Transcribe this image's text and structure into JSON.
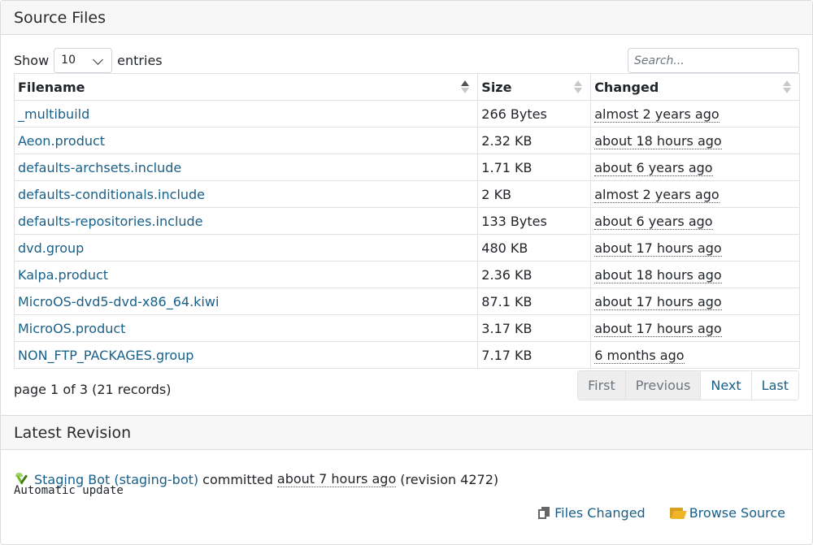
{
  "source_files": {
    "title": "Source Files",
    "show_label": "Show",
    "entries_label": "entries",
    "page_length": "10",
    "search_placeholder": "Search...",
    "columns": [
      "Filename",
      "Size",
      "Changed"
    ],
    "rows": [
      {
        "filename": "_multibuild",
        "size": "266 Bytes",
        "changed": "almost 2 years ago"
      },
      {
        "filename": "Aeon.product",
        "size": "2.32 KB",
        "changed": "about 18 hours ago"
      },
      {
        "filename": "defaults-archsets.include",
        "size": "1.71 KB",
        "changed": "about 6 years ago"
      },
      {
        "filename": "defaults-conditionals.include",
        "size": "2 KB",
        "changed": "almost 2 years ago"
      },
      {
        "filename": "defaults-repositories.include",
        "size": "133 Bytes",
        "changed": "about 6 years ago"
      },
      {
        "filename": "dvd.group",
        "size": "480 KB",
        "changed": "about 17 hours ago"
      },
      {
        "filename": "Kalpa.product",
        "size": "2.36 KB",
        "changed": "about 18 hours ago"
      },
      {
        "filename": "MicroOS-dvd5-dvd-x86_64.kiwi",
        "size": "87.1 KB",
        "changed": "about 17 hours ago"
      },
      {
        "filename": "MicroOS.product",
        "size": "3.17 KB",
        "changed": "about 17 hours ago"
      },
      {
        "filename": "NON_FTP_PACKAGES.group",
        "size": "7.17 KB",
        "changed": "6 months ago"
      }
    ],
    "info": "page 1 of 3 (21 records)",
    "pagination": {
      "first": "First",
      "previous": "Previous",
      "next": "Next",
      "last": "Last"
    }
  },
  "latest_revision": {
    "title": "Latest Revision",
    "author": "Staging Bot (staging-bot)",
    "committed_text": "committed",
    "time": "about 7 hours ago",
    "revision_prefix": "(revision",
    "revision": "4272",
    "revision_suffix": ")",
    "message": "Automatic update",
    "files_changed_label": "Files Changed",
    "browse_source_label": "Browse Source"
  }
}
